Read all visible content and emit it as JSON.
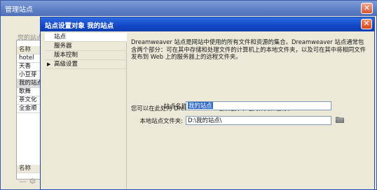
{
  "outer_window": {
    "title": "管理站点",
    "close_glyph": "✕",
    "list_label": "您的站点",
    "sites": [
      "名称",
      "hotel",
      "天香",
      "小豆芽",
      "我的站点",
      "歌舞",
      "茶文化",
      "全金顺"
    ],
    "footer_label": "名称",
    "bottom_icons": "— ⚙"
  },
  "dialog": {
    "title": "站点设置对象 我的站点",
    "close_glyph": "✕",
    "nav": [
      {
        "label": "站点",
        "active": true
      },
      {
        "label": "服务器",
        "active": false
      },
      {
        "label": "版本控制",
        "active": false
      },
      {
        "label": "高级设置",
        "active": false,
        "arrow": "▶"
      }
    ],
    "description": "Dreamweaver 站点是网站中使用的所有文件和资源的集合。Dreamweaver 站点通常包含两个部分：可在其中存储和处理文件的计算机上的本地文件夹，以及可在其中将相同文件发布到 Web 上的服务器上的远程文件夹。",
    "hint": "您可以在此处为 Dreamweaver 站点选择本地文件夹和名称。",
    "site_name_label": "站点名称:",
    "site_name_value": "我的站点",
    "local_folder_label": "本地站点文件夹:",
    "local_folder_value": "D:\\我的站点\\"
  },
  "colors": {
    "dialog_title": "#1449c9",
    "selection": "#3169c6"
  }
}
